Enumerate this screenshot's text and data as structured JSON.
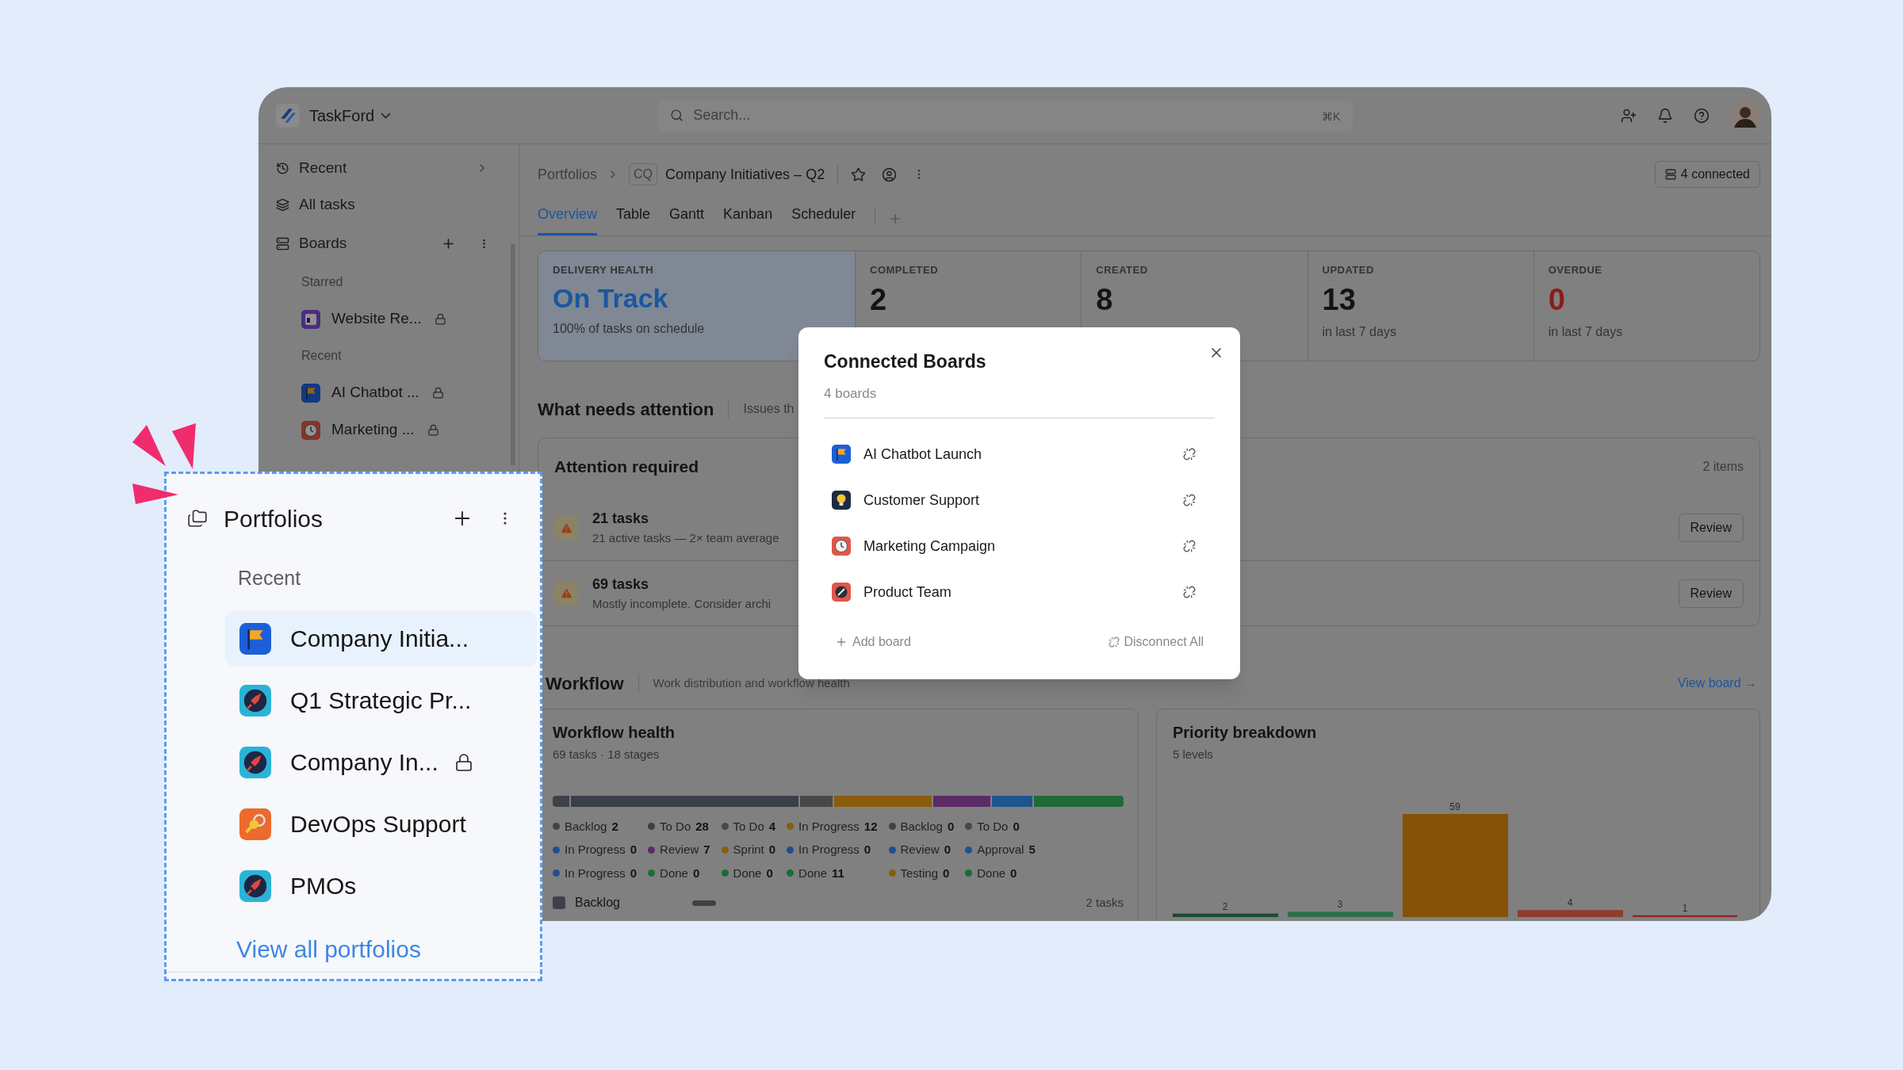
{
  "app": {
    "name": "TaskFord"
  },
  "search": {
    "placeholder": "Search...",
    "shortcut": "⌘K"
  },
  "sidebar": {
    "nav": [
      {
        "label": "Recent",
        "kind": "recent"
      },
      {
        "label": "All tasks",
        "kind": "tasks"
      }
    ],
    "boards": {
      "title": "Boards",
      "groups": [
        {
          "title": "Starred",
          "items": [
            {
              "label": "Website Re...",
              "kind": "window",
              "locked": true
            }
          ]
        },
        {
          "title": "Recent",
          "items": [
            {
              "label": "AI Chatbot ...",
              "kind": "flag",
              "locked": true
            },
            {
              "label": "Marketing ...",
              "kind": "clock",
              "locked": true
            }
          ]
        }
      ]
    }
  },
  "breadcrumb": {
    "parent": "Portfolios",
    "badge": "CQ",
    "title": "Company Initiatives – Q2"
  },
  "connected_button": "4 connected",
  "tabs": [
    {
      "label": "Overview",
      "selected": true
    },
    {
      "label": "Table",
      "selected": false
    },
    {
      "label": "Gantt",
      "selected": false
    },
    {
      "label": "Kanban",
      "selected": false
    },
    {
      "label": "Scheduler",
      "selected": false
    }
  ],
  "stats": [
    {
      "label": "DELIVERY HEALTH",
      "value": "On Track",
      "note": "100% of tasks on schedule",
      "kind": "health"
    },
    {
      "label": "COMPLETED",
      "value": "2",
      "kind": "count"
    },
    {
      "label": "CREATED",
      "value": "8",
      "kind": "count"
    },
    {
      "label": "UPDATED",
      "value": "13",
      "note": "in last 7 days",
      "kind": "count"
    },
    {
      "label": "OVERDUE",
      "value": "0",
      "note": "in last 7 days",
      "kind": "alert"
    }
  ],
  "attention": {
    "title": "What needs attention",
    "subtitle": "Issues th",
    "card_title": "Attention required",
    "count": "2 items",
    "rows": [
      {
        "title": "21 tasks",
        "detail": "21 active tasks — 2× team average",
        "action": "Review"
      },
      {
        "title": "69 tasks",
        "detail": "Mostly incomplete. Consider archi",
        "action": "Review"
      }
    ]
  },
  "workflow": {
    "title": "Workflow",
    "subtitle": "Work distribution and workflow health",
    "link": "View board →",
    "health": {
      "title": "Workflow health",
      "subtitle": "69 tasks · 18 stages",
      "stages": [
        {
          "label": "Backlog",
          "count": "2",
          "color": "#3e4248"
        },
        {
          "label": "To Do",
          "count": "28",
          "color": "#3a3f4a"
        },
        {
          "label": "To Do",
          "count": "4",
          "color": "#484848"
        },
        {
          "label": "In Progress",
          "count": "12",
          "color": "#8a5c0c"
        },
        {
          "label": "Backlog",
          "count": "0",
          "color": "#3e4248"
        },
        {
          "label": "To Do",
          "count": "0",
          "color": "#484848"
        },
        {
          "label": "In Progress",
          "count": "0",
          "color": "#204f8c"
        },
        {
          "label": "Review",
          "count": "7",
          "color": "#5b2b68"
        },
        {
          "label": "Sprint",
          "count": "0",
          "color": "#8a5c0c"
        },
        {
          "label": "In Progress",
          "count": "0",
          "color": "#204f8c"
        },
        {
          "label": "Review",
          "count": "0",
          "color": "#204f8c"
        },
        {
          "label": "Approval",
          "count": "5",
          "color": "#1e548f"
        },
        {
          "label": "In Progress",
          "count": "0",
          "color": "#204f8c"
        },
        {
          "label": "Done",
          "count": "0",
          "color": "#1e6b37"
        },
        {
          "label": "Done",
          "count": "0",
          "color": "#1e6b37"
        },
        {
          "label": "Done",
          "count": "11",
          "color": "#1e6b37"
        },
        {
          "label": "Testing",
          "count": "0",
          "color": "#8a5c0c"
        },
        {
          "label": "Done",
          "count": "0",
          "color": "#1e6b37"
        }
      ],
      "group": {
        "label": "Backlog",
        "count": "2 tasks"
      }
    },
    "priority": {
      "title": "Priority breakdown",
      "subtitle": "5 levels",
      "chart_data": {
        "type": "bar",
        "values": [
          2,
          3,
          59,
          4,
          1
        ],
        "colors": [
          "#1c4a32",
          "#2b6e4a",
          "#855207",
          "#8f3b2e",
          "#8c2323"
        ],
        "data_labels": true
      }
    }
  },
  "modal": {
    "title": "Connected Boards",
    "subtitle": "4 boards",
    "boards": [
      {
        "label": "AI Chatbot Launch",
        "kind": "flag"
      },
      {
        "label": "Customer Support",
        "kind": "bulb"
      },
      {
        "label": "Marketing Campaign",
        "kind": "clock"
      },
      {
        "label": "Product Team",
        "kind": "dial"
      }
    ],
    "add": "Add board",
    "disconnect": "Disconnect All"
  },
  "callout": {
    "title": "Portfolios",
    "section": "Recent",
    "items": [
      {
        "label": "Company Initia...",
        "kind": "flag",
        "selected": true,
        "locked": false
      },
      {
        "label": "Q1 Strategic Pr...",
        "kind": "rocket",
        "selected": false,
        "locked": false
      },
      {
        "label": "Company In...",
        "kind": "rocket",
        "selected": false,
        "locked": true
      },
      {
        "label": "DevOps Support",
        "kind": "key",
        "selected": false,
        "locked": false
      },
      {
        "label": "PMOs",
        "kind": "rocket",
        "selected": false,
        "locked": false
      }
    ],
    "link": "View all portfolios"
  }
}
